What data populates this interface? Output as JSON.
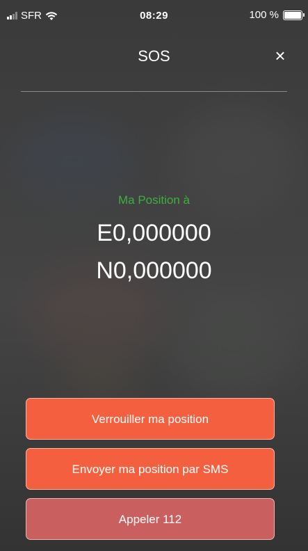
{
  "status_bar": {
    "carrier": "SFR",
    "time": "08:29",
    "battery": "100 %",
    "battery_level": 1.0
  },
  "header": {
    "title": "SOS",
    "close": "×"
  },
  "position": {
    "label": "Ma Position à",
    "longitude": "E0,000000",
    "latitude": "N0,000000"
  },
  "actions": {
    "lock": "Verrouiller ma position",
    "sms": "Envoyer ma position par SMS",
    "call": "Appeler 112"
  },
  "colors": {
    "accent_green": "#3fae3f",
    "button_orange": "#f4603f",
    "button_call": "#c95f5e"
  },
  "icons": [
    "signal-icon",
    "wifi-icon",
    "battery-icon",
    "close-icon"
  ]
}
